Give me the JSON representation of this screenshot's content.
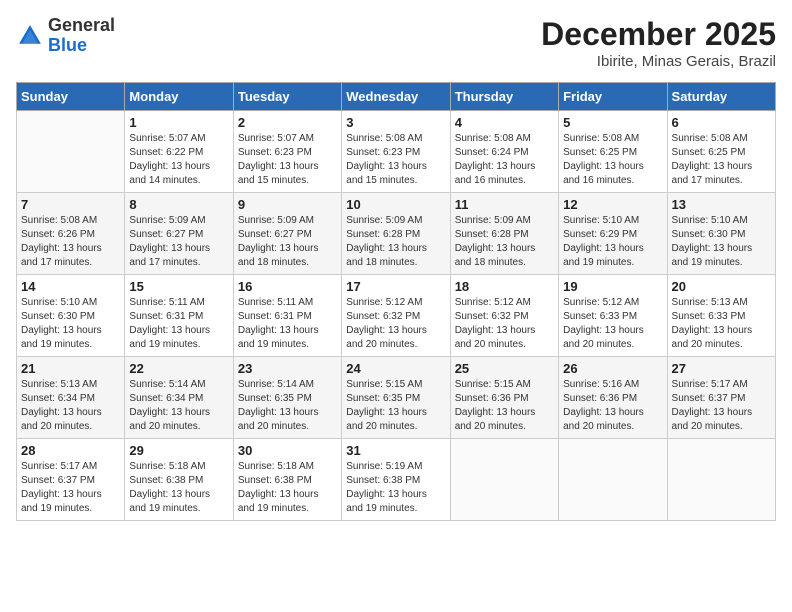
{
  "header": {
    "logo_general": "General",
    "logo_blue": "Blue",
    "month_title": "December 2025",
    "location": "Ibirite, Minas Gerais, Brazil"
  },
  "weekdays": [
    "Sunday",
    "Monday",
    "Tuesday",
    "Wednesday",
    "Thursday",
    "Friday",
    "Saturday"
  ],
  "weeks": [
    [
      {
        "day": "",
        "sunrise": "",
        "sunset": "",
        "daylight": ""
      },
      {
        "day": "1",
        "sunrise": "Sunrise: 5:07 AM",
        "sunset": "Sunset: 6:22 PM",
        "daylight": "Daylight: 13 hours and 14 minutes."
      },
      {
        "day": "2",
        "sunrise": "Sunrise: 5:07 AM",
        "sunset": "Sunset: 6:23 PM",
        "daylight": "Daylight: 13 hours and 15 minutes."
      },
      {
        "day": "3",
        "sunrise": "Sunrise: 5:08 AM",
        "sunset": "Sunset: 6:23 PM",
        "daylight": "Daylight: 13 hours and 15 minutes."
      },
      {
        "day": "4",
        "sunrise": "Sunrise: 5:08 AM",
        "sunset": "Sunset: 6:24 PM",
        "daylight": "Daylight: 13 hours and 16 minutes."
      },
      {
        "day": "5",
        "sunrise": "Sunrise: 5:08 AM",
        "sunset": "Sunset: 6:25 PM",
        "daylight": "Daylight: 13 hours and 16 minutes."
      },
      {
        "day": "6",
        "sunrise": "Sunrise: 5:08 AM",
        "sunset": "Sunset: 6:25 PM",
        "daylight": "Daylight: 13 hours and 17 minutes."
      }
    ],
    [
      {
        "day": "7",
        "sunrise": "Sunrise: 5:08 AM",
        "sunset": "Sunset: 6:26 PM",
        "daylight": "Daylight: 13 hours and 17 minutes."
      },
      {
        "day": "8",
        "sunrise": "Sunrise: 5:09 AM",
        "sunset": "Sunset: 6:27 PM",
        "daylight": "Daylight: 13 hours and 17 minutes."
      },
      {
        "day": "9",
        "sunrise": "Sunrise: 5:09 AM",
        "sunset": "Sunset: 6:27 PM",
        "daylight": "Daylight: 13 hours and 18 minutes."
      },
      {
        "day": "10",
        "sunrise": "Sunrise: 5:09 AM",
        "sunset": "Sunset: 6:28 PM",
        "daylight": "Daylight: 13 hours and 18 minutes."
      },
      {
        "day": "11",
        "sunrise": "Sunrise: 5:09 AM",
        "sunset": "Sunset: 6:28 PM",
        "daylight": "Daylight: 13 hours and 18 minutes."
      },
      {
        "day": "12",
        "sunrise": "Sunrise: 5:10 AM",
        "sunset": "Sunset: 6:29 PM",
        "daylight": "Daylight: 13 hours and 19 minutes."
      },
      {
        "day": "13",
        "sunrise": "Sunrise: 5:10 AM",
        "sunset": "Sunset: 6:30 PM",
        "daylight": "Daylight: 13 hours and 19 minutes."
      }
    ],
    [
      {
        "day": "14",
        "sunrise": "Sunrise: 5:10 AM",
        "sunset": "Sunset: 6:30 PM",
        "daylight": "Daylight: 13 hours and 19 minutes."
      },
      {
        "day": "15",
        "sunrise": "Sunrise: 5:11 AM",
        "sunset": "Sunset: 6:31 PM",
        "daylight": "Daylight: 13 hours and 19 minutes."
      },
      {
        "day": "16",
        "sunrise": "Sunrise: 5:11 AM",
        "sunset": "Sunset: 6:31 PM",
        "daylight": "Daylight: 13 hours and 19 minutes."
      },
      {
        "day": "17",
        "sunrise": "Sunrise: 5:12 AM",
        "sunset": "Sunset: 6:32 PM",
        "daylight": "Daylight: 13 hours and 20 minutes."
      },
      {
        "day": "18",
        "sunrise": "Sunrise: 5:12 AM",
        "sunset": "Sunset: 6:32 PM",
        "daylight": "Daylight: 13 hours and 20 minutes."
      },
      {
        "day": "19",
        "sunrise": "Sunrise: 5:12 AM",
        "sunset": "Sunset: 6:33 PM",
        "daylight": "Daylight: 13 hours and 20 minutes."
      },
      {
        "day": "20",
        "sunrise": "Sunrise: 5:13 AM",
        "sunset": "Sunset: 6:33 PM",
        "daylight": "Daylight: 13 hours and 20 minutes."
      }
    ],
    [
      {
        "day": "21",
        "sunrise": "Sunrise: 5:13 AM",
        "sunset": "Sunset: 6:34 PM",
        "daylight": "Daylight: 13 hours and 20 minutes."
      },
      {
        "day": "22",
        "sunrise": "Sunrise: 5:14 AM",
        "sunset": "Sunset: 6:34 PM",
        "daylight": "Daylight: 13 hours and 20 minutes."
      },
      {
        "day": "23",
        "sunrise": "Sunrise: 5:14 AM",
        "sunset": "Sunset: 6:35 PM",
        "daylight": "Daylight: 13 hours and 20 minutes."
      },
      {
        "day": "24",
        "sunrise": "Sunrise: 5:15 AM",
        "sunset": "Sunset: 6:35 PM",
        "daylight": "Daylight: 13 hours and 20 minutes."
      },
      {
        "day": "25",
        "sunrise": "Sunrise: 5:15 AM",
        "sunset": "Sunset: 6:36 PM",
        "daylight": "Daylight: 13 hours and 20 minutes."
      },
      {
        "day": "26",
        "sunrise": "Sunrise: 5:16 AM",
        "sunset": "Sunset: 6:36 PM",
        "daylight": "Daylight: 13 hours and 20 minutes."
      },
      {
        "day": "27",
        "sunrise": "Sunrise: 5:17 AM",
        "sunset": "Sunset: 6:37 PM",
        "daylight": "Daylight: 13 hours and 20 minutes."
      }
    ],
    [
      {
        "day": "28",
        "sunrise": "Sunrise: 5:17 AM",
        "sunset": "Sunset: 6:37 PM",
        "daylight": "Daylight: 13 hours and 19 minutes."
      },
      {
        "day": "29",
        "sunrise": "Sunrise: 5:18 AM",
        "sunset": "Sunset: 6:38 PM",
        "daylight": "Daylight: 13 hours and 19 minutes."
      },
      {
        "day": "30",
        "sunrise": "Sunrise: 5:18 AM",
        "sunset": "Sunset: 6:38 PM",
        "daylight": "Daylight: 13 hours and 19 minutes."
      },
      {
        "day": "31",
        "sunrise": "Sunrise: 5:19 AM",
        "sunset": "Sunset: 6:38 PM",
        "daylight": "Daylight: 13 hours and 19 minutes."
      },
      {
        "day": "",
        "sunrise": "",
        "sunset": "",
        "daylight": ""
      },
      {
        "day": "",
        "sunrise": "",
        "sunset": "",
        "daylight": ""
      },
      {
        "day": "",
        "sunrise": "",
        "sunset": "",
        "daylight": ""
      }
    ]
  ]
}
